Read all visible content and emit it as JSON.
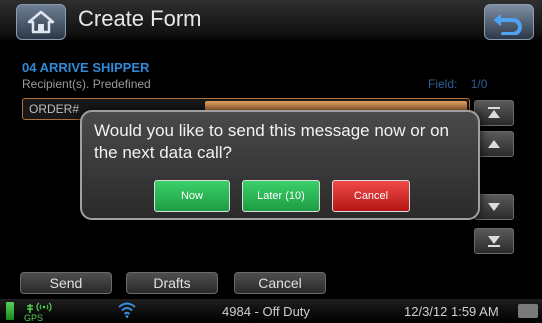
{
  "header": {
    "title": "Create Form",
    "home_icon": "home-icon",
    "back_icon": "back-arrow-icon"
  },
  "form": {
    "name": "04 ARRIVE SHIPPER",
    "recipients": "Recipient(s). Predefined",
    "field_label": "Field:",
    "field_position": "1/0",
    "order_label": "ORDER#"
  },
  "scroll": {
    "top_icon": "scroll-to-top-icon",
    "up_icon": "scroll-up-icon",
    "down_icon": "scroll-down-icon",
    "bottom_icon": "scroll-to-bottom-icon"
  },
  "dialog": {
    "message": "Would you like to send this message now or on the next data call?",
    "now_label": "Now",
    "later_label": "Later (10)",
    "cancel_label": "Cancel"
  },
  "bottom_bar": {
    "send_label": "Send",
    "drafts_label": "Drafts",
    "cancel_label": "Cancel"
  },
  "status": {
    "gps_label": "GPS",
    "status_text": "4984 - Off Duty",
    "datetime": "12/3/12 1:59 AM",
    "battery_icon": "battery-icon",
    "wifi_icon": "wifi-icon",
    "keyboard_icon": "keyboard-icon"
  },
  "colors": {
    "accent_blue": "#2f8ad8",
    "now_green": "#2bb655",
    "cancel_red": "#d92424",
    "order_orange": "#c87a40"
  }
}
